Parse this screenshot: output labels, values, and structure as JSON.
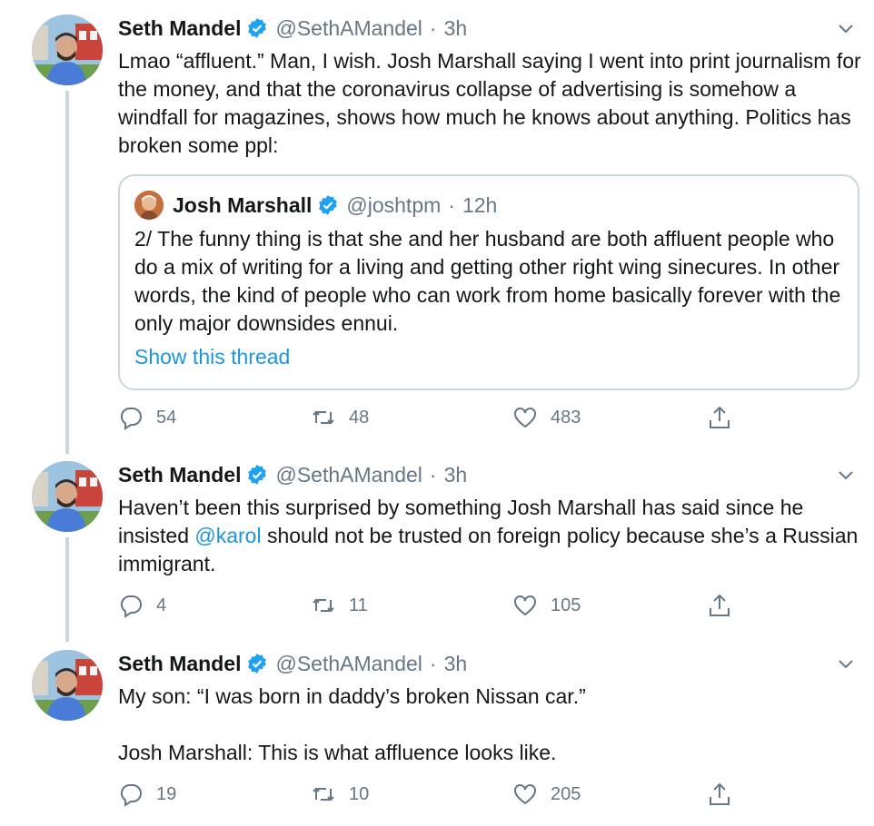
{
  "colors": {
    "link": "#1b95e0",
    "secondary": "#657786",
    "border": "#ccd6dd",
    "verified": "#1da1f2"
  },
  "tweets": [
    {
      "name": "Seth Mandel",
      "handle": "@SethAMandel",
      "separator": "·",
      "time": "3h",
      "text": "Lmao “affluent.” Man, I wish. Josh Marshall saying I went into print journalism for the money, and that the coronavirus collapse of advertising is somehow a windfall for magazines, shows how much he knows about anything. Politics has broken some ppl:",
      "quote": {
        "name": "Josh Marshall",
        "handle": "@joshtpm",
        "separator": "·",
        "time": "12h",
        "text": "2/ The funny thing is that she and her husband are both affluent people who do a mix of writing for a living and getting other right wing sinecures. In other words, the kind of people who can work from home basically forever with the only major downsides ennui.",
        "link": "Show this thread"
      },
      "replies": "54",
      "retweets": "48",
      "likes": "483"
    },
    {
      "name": "Seth Mandel",
      "handle": "@SethAMandel",
      "separator": "·",
      "time": "3h",
      "text_before": "Haven’t been this surprised by something Josh Marshall has said since he insisted ",
      "mention": "@karol",
      "text_after": " should not be trusted on foreign policy because she’s a Russian immigrant.",
      "replies": "4",
      "retweets": "11",
      "likes": "105"
    },
    {
      "name": "Seth Mandel",
      "handle": "@SethAMandel",
      "separator": "·",
      "time": "3h",
      "line1": "My son: “I was born in daddy’s broken Nissan car.”",
      "line2": "Josh Marshall: This is what affluence looks like.",
      "replies": "19",
      "retweets": "10",
      "likes": "205"
    }
  ]
}
